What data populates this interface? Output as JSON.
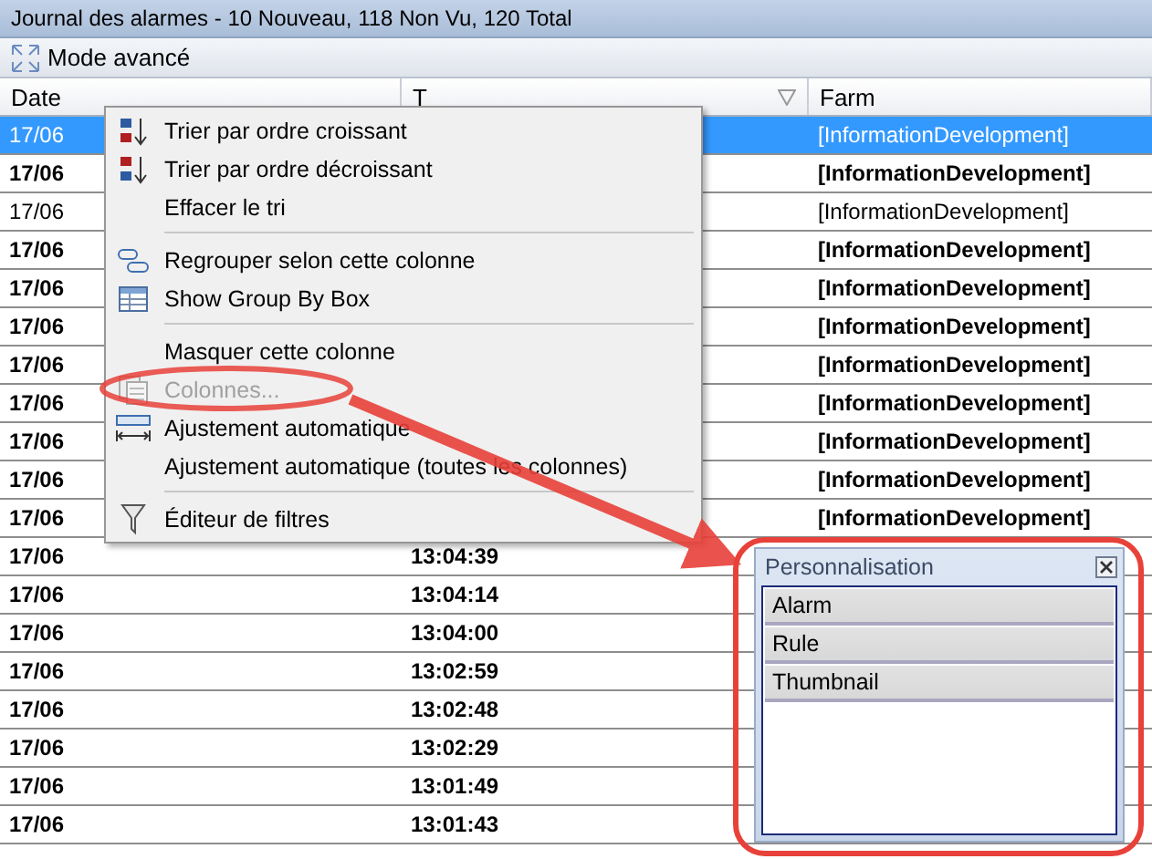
{
  "window": {
    "title": "Journal des alarmes - 10 Nouveau, 118 Non Vu, 120 Total"
  },
  "toolbar": {
    "button": "Mode avancé"
  },
  "table": {
    "columns": [
      "Date",
      "T",
      "Farm"
    ],
    "rows": [
      {
        "date": "17/06",
        "farm": "[InformationDevelopment]",
        "bold": false,
        "selected": true
      },
      {
        "date": "17/06",
        "farm": "[InformationDevelopment]",
        "bold": true,
        "selected": false
      },
      {
        "date": "17/06",
        "farm": "[InformationDevelopment]",
        "bold": false,
        "selected": false
      },
      {
        "date": "17/06",
        "farm": "[InformationDevelopment]",
        "bold": true,
        "selected": false
      },
      {
        "date": "17/06",
        "farm": "[InformationDevelopment]",
        "bold": true,
        "selected": false
      },
      {
        "date": "17/06",
        "farm": "[InformationDevelopment]",
        "bold": true,
        "selected": false
      },
      {
        "date": "17/06",
        "farm": "[InformationDevelopment]",
        "bold": true,
        "selected": false
      },
      {
        "date": "17/06",
        "farm": "[InformationDevelopment]",
        "bold": true,
        "selected": false
      },
      {
        "date": "17/06",
        "farm": "[InformationDevelopment]",
        "bold": true,
        "selected": false
      },
      {
        "date": "17/06",
        "farm": "[InformationDevelopment]",
        "bold": true,
        "selected": false
      },
      {
        "date": "17/06",
        "farm": "[InformationDevelopment]",
        "bold": true,
        "selected": false
      },
      {
        "date": "17/06",
        "time": "13:04:39",
        "bold": true,
        "selected": false
      },
      {
        "date": "17/06",
        "time": "13:04:14",
        "bold": true,
        "selected": false
      },
      {
        "date": "17/06",
        "time": "13:04:00",
        "bold": true,
        "selected": false
      },
      {
        "date": "17/06",
        "time": "13:02:59",
        "bold": true,
        "selected": false
      },
      {
        "date": "17/06",
        "time": "13:02:48",
        "bold": true,
        "selected": false
      },
      {
        "date": "17/06",
        "time": "13:02:29",
        "bold": true,
        "selected": false
      },
      {
        "date": "17/06",
        "time": "13:01:49",
        "bold": true,
        "selected": false
      },
      {
        "date": "17/06",
        "time": "13:01:43",
        "bold": true,
        "selected": false
      }
    ]
  },
  "context_menu": {
    "items": [
      {
        "kind": "sort-asc",
        "label": "Trier par ordre croissant",
        "disabled": false
      },
      {
        "kind": "sort-desc",
        "label": "Trier par ordre décroissant",
        "disabled": false
      },
      {
        "kind": "plain",
        "label": "Effacer le tri",
        "disabled": false
      },
      {
        "kind": "separator"
      },
      {
        "kind": "group",
        "label": "Regrouper selon cette colonne",
        "disabled": false
      },
      {
        "kind": "groupbox",
        "label": "Show Group By Box",
        "disabled": false
      },
      {
        "kind": "separator"
      },
      {
        "kind": "plain",
        "label": "Masquer cette colonne",
        "disabled": false
      },
      {
        "kind": "columns",
        "label": "Colonnes...",
        "disabled": true
      },
      {
        "kind": "autofit",
        "label": "Ajustement automatique",
        "disabled": false
      },
      {
        "kind": "plain",
        "label": "Ajustement automatique (toutes les colonnes)",
        "disabled": false
      },
      {
        "kind": "separator"
      },
      {
        "kind": "filter",
        "label": "Éditeur de filtres",
        "disabled": false
      }
    ]
  },
  "customization_panel": {
    "title": "Personnalisation",
    "items": [
      "Alarm",
      "Rule",
      "Thumbnail"
    ]
  }
}
